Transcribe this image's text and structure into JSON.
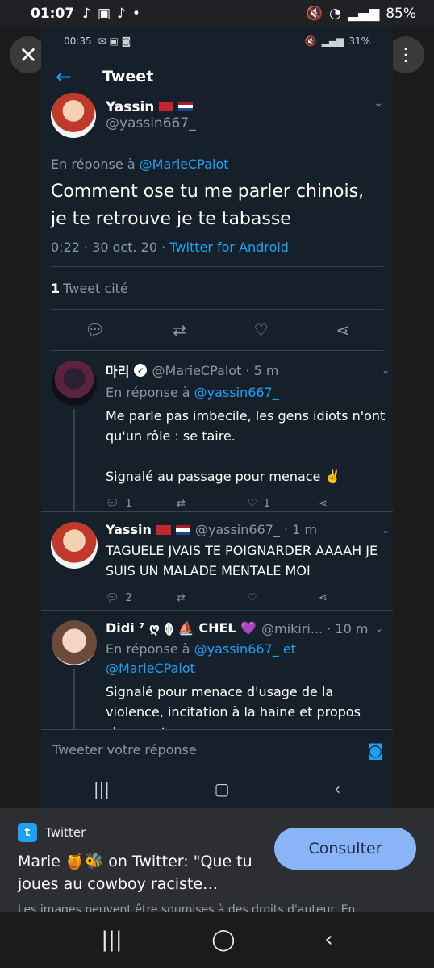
{
  "outer_status": {
    "time": "01:07",
    "battery": "85%"
  },
  "inner_status": {
    "time": "00:35",
    "battery": "31%"
  },
  "header": {
    "title": "Tweet"
  },
  "main_tweet": {
    "name": "Yassin",
    "handle": "@yassin667_",
    "reply_prefix": "En réponse à",
    "reply_to": "@MarieCPalot",
    "text": "Comment ose tu me parler chinois, je te retrouve je te tabasse",
    "timestamp": "0:22 · 30 oct. 20 ·",
    "client": "Twitter for Android",
    "quote_count": "1",
    "quote_label": "Tweet cité"
  },
  "replies": [
    {
      "name": "마리",
      "handle": "@MarieCPalot · 5 m",
      "reply_prefix": "En réponse à",
      "reply_to": "@yassin667_",
      "text": "Me parle pas imbecile, les gens idiots n'ont qu'un rôle : se taire.",
      "text2": "Signalé au passage pour menace ✌️",
      "reply_count": "1",
      "like_count": "1"
    },
    {
      "name": "Yassin",
      "handle": "@yassin667_ · 1 m",
      "text": "TAGUELE JVAIS TE POIGNARDER AAAAH JE SUIS UN MALADE MENTALE MOI",
      "reply_count": "2"
    },
    {
      "name": "Didi ⁷ ღ ⟬⟭ ⛵ CHEL 💜",
      "handle": "@mikiri... · 10 m",
      "reply_prefix": "En réponse à",
      "reply_to": "@yassin667_ et @MarieCPalot",
      "text": "Signalé pour menace d'usage de la violence, incitation à la haine et propos choquants"
    }
  ],
  "compose": {
    "placeholder": "Tweeter votre réponse"
  },
  "sheet": {
    "source": "Twitter",
    "title": "Marie 🍯🐝 on Twitter: \"Que tu joues au cowboy raciste…",
    "note": "Les images peuvent être soumises à des droits d'auteur. En",
    "button": "Consulter"
  }
}
